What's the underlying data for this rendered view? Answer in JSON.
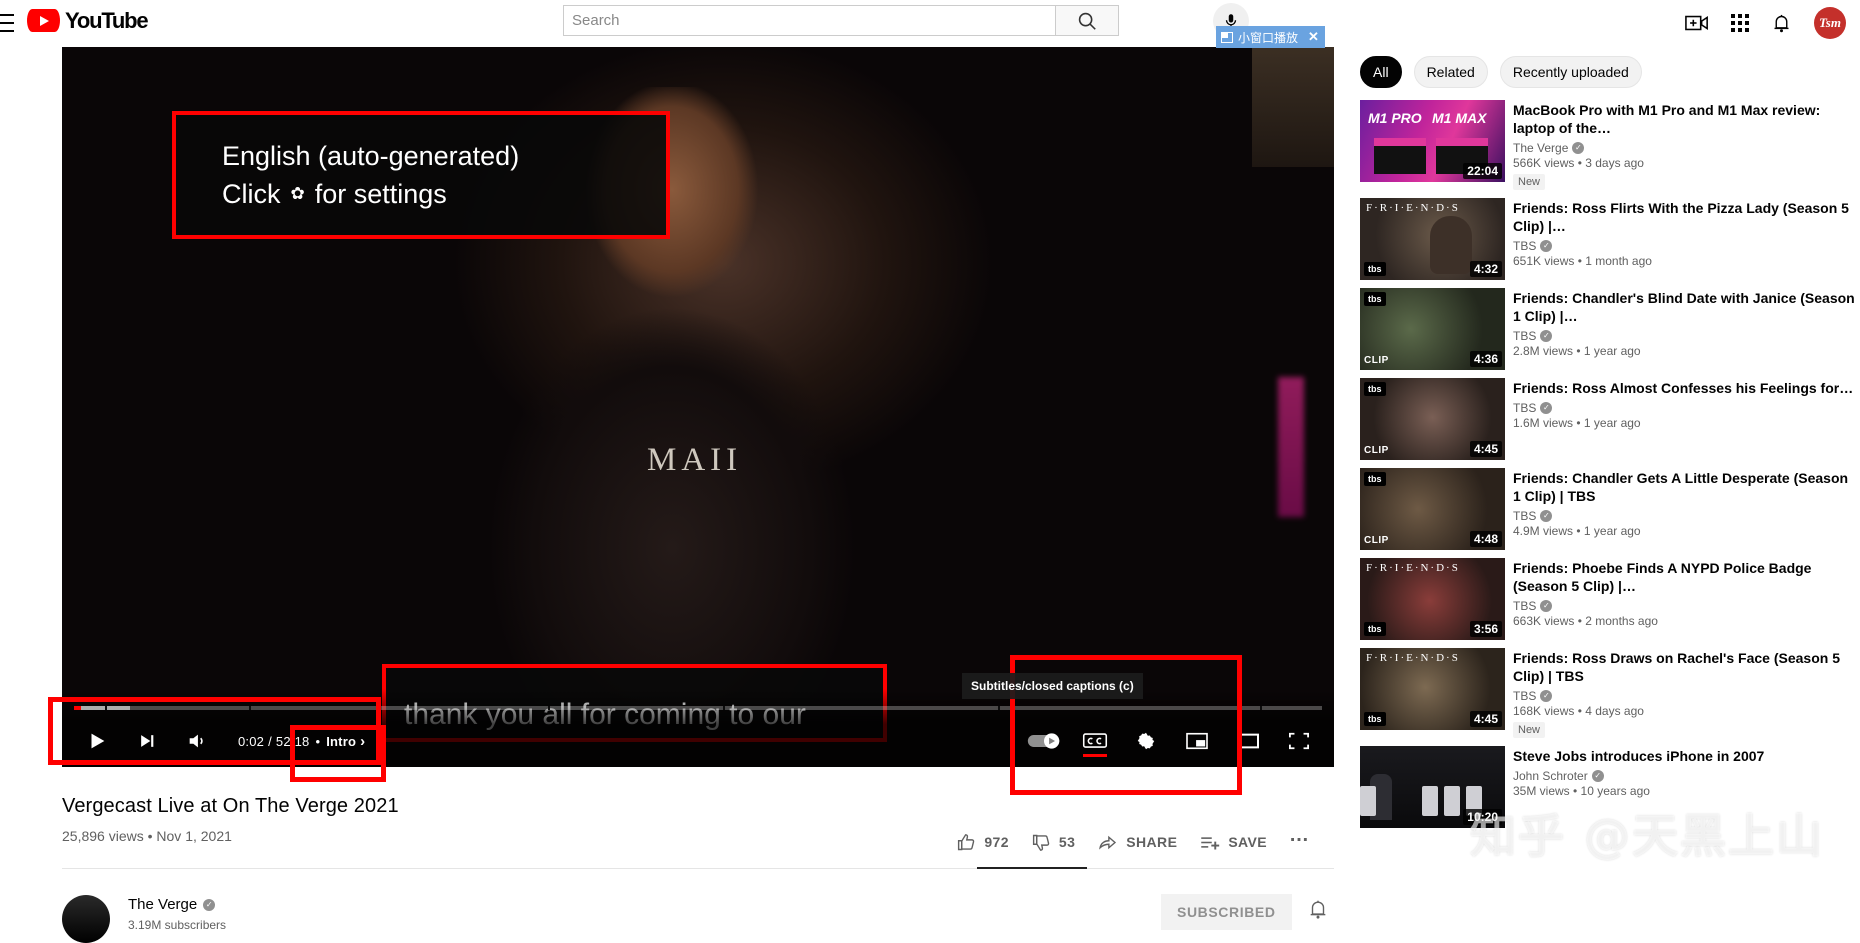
{
  "header": {
    "logo_text": "YouTube",
    "search_placeholder": "Search",
    "menu_icon": "hamburger-menu-icon",
    "search_icon": "search-icon",
    "mic_icon": "microphone-icon",
    "create_icon": "create-video-icon",
    "apps_icon": "apps-grid-icon",
    "notifications_icon": "notifications-bell-icon",
    "avatar_initials": "Tsm"
  },
  "pip_tooltip": {
    "label": "小窗口播放",
    "close_label": "✕",
    "background": "#6aa3e0"
  },
  "player": {
    "caption_overlay_line1": "English (auto-generated)",
    "caption_overlay_line2_before": "Click",
    "caption_overlay_line2_after": "for settings",
    "caption_gear_glyph": "✿",
    "caption_text": "thank you all for coming to our",
    "stage_text": "MAII",
    "annotation_color": "#ff0000",
    "controls": {
      "play_label": "play-button",
      "next_label": "next-video-button",
      "volume_label": "volume-button",
      "time_current": "0:02",
      "time_separator": "/",
      "time_total": "52:18",
      "chapter_bullet": "•",
      "chapter_name": "Intro",
      "chapter_arrow": "›",
      "autoplay_label": "autoplay-toggle",
      "cc_label": "CC",
      "settings_label": "settings-gear",
      "miniplayer_label": "miniplayer",
      "theater_label": "theater-mode",
      "fullscreen_label": "fullscreen",
      "cc_tooltip": "Subtitles/closed captions (c)"
    }
  },
  "video": {
    "title": "Vergecast Live at On The Verge 2021",
    "views": "25,896 views",
    "separator": "•",
    "date": "Nov 1, 2021",
    "like_count": "972",
    "dislike_count": "53",
    "share_label": "SHARE",
    "save_label": "SAVE",
    "more_label": "…"
  },
  "channel": {
    "name": "The Verge",
    "subscribers": "3.19M subscribers",
    "subscribe_label": "SUBSCRIBED",
    "bell_label": "notification-bell"
  },
  "sidebar": {
    "chips": [
      {
        "label": "All",
        "active": true
      },
      {
        "label": "Related",
        "active": false
      },
      {
        "label": "Recently uploaded",
        "active": false
      }
    ],
    "videos": [
      {
        "title": "MacBook Pro with M1 Pro and M1 Max review: laptop of the…",
        "channel": "The Verge",
        "stats": "566K views • 3 days ago",
        "duration": "22:04",
        "badge": "New",
        "art": "art-m1",
        "overlay": "",
        "corner": ""
      },
      {
        "title": "Friends: Ross Flirts With the Pizza Lady (Season 5 Clip) |…",
        "channel": "TBS",
        "stats": "651K views • 1 month ago",
        "duration": "4:32",
        "badge": "",
        "art": "art-f1",
        "overlay": "F·R·I·E·N·D·S",
        "corner": "tbs"
      },
      {
        "title": "Friends: Chandler's Blind Date with Janice (Season 1 Clip) |…",
        "channel": "TBS",
        "stats": "2.8M views • 1 year ago",
        "duration": "4:36",
        "badge": "",
        "art": "art-f2",
        "overlay": "",
        "corner": "CLIP"
      },
      {
        "title": "Friends: Ross Almost Confesses his Feelings for…",
        "channel": "TBS",
        "stats": "1.6M views • 1 year ago",
        "duration": "4:45",
        "badge": "",
        "art": "art-f3",
        "overlay": "",
        "corner": "CLIP"
      },
      {
        "title": "Friends: Chandler Gets A Little Desperate (Season 1 Clip) | TBS",
        "channel": "TBS",
        "stats": "4.9M views • 1 year ago",
        "duration": "4:48",
        "badge": "",
        "art": "art-f4",
        "overlay": "",
        "corner": "CLIP"
      },
      {
        "title": "Friends: Phoebe Finds A NYPD Police Badge (Season 5 Clip) |…",
        "channel": "TBS",
        "stats": "663K views • 2 months ago",
        "duration": "3:56",
        "badge": "",
        "art": "art-f5",
        "overlay": "F·R·I·E·N·D·S",
        "corner": "tbs"
      },
      {
        "title": "Friends: Ross Draws on Rachel's Face (Season 5 Clip) | TBS",
        "channel": "TBS",
        "stats": "168K views • 4 days ago",
        "duration": "4:45",
        "badge": "New",
        "art": "art-f6",
        "overlay": "F·R·I·E·N·D·S",
        "corner": "tbs"
      },
      {
        "title": "Steve Jobs introduces iPhone in 2007",
        "channel": "John Schroter",
        "stats": "35M views • 10 years ago",
        "duration": "10:20",
        "badge": "",
        "art": "art-jobs",
        "overlay": "",
        "corner": ""
      }
    ]
  },
  "watermark": {
    "text": "知乎 @天黑上山"
  }
}
